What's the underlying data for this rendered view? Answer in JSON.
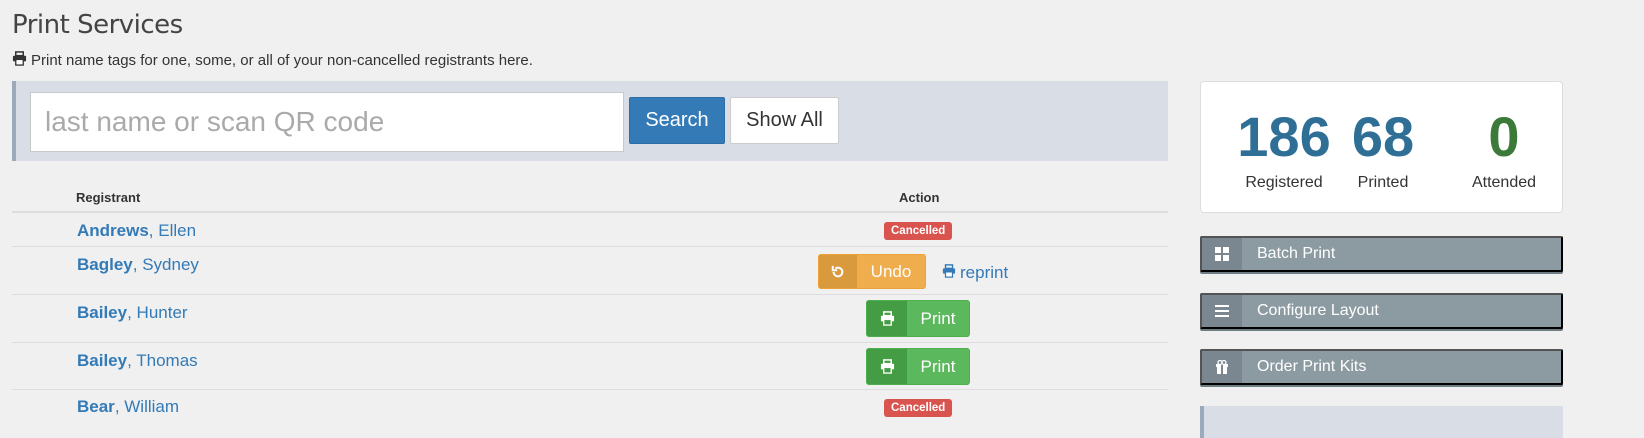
{
  "header": {
    "title": "Print Services",
    "subtitle": "Print name tags for one, some, or all of your non-cancelled registrants here."
  },
  "search": {
    "placeholder": "last name or scan QR code",
    "search_label": "Search",
    "show_all_label": "Show All"
  },
  "table": {
    "col_registrant": "Registrant",
    "col_action": "Action",
    "rows": [
      {
        "last": "Andrews",
        "first": ", Ellen",
        "status": "Cancelled"
      },
      {
        "last": "Bagley",
        "first": ", Sydney",
        "undo": "Undo",
        "reprint": "reprint"
      },
      {
        "last": "Bailey",
        "first": ", Hunter",
        "print": "Print"
      },
      {
        "last": "Bailey",
        "first": ", Thomas",
        "print": "Print"
      },
      {
        "last": "Bear",
        "first": ", William",
        "status": "Cancelled"
      }
    ]
  },
  "stats": {
    "registered": {
      "value": "186",
      "label": "Registered",
      "color": "#2f6f96"
    },
    "printed": {
      "value": "68",
      "label": "Printed",
      "color": "#2f6f96"
    },
    "attended": {
      "value": "0",
      "label": "Attended",
      "color": "#3c7a3a"
    }
  },
  "sidebar": {
    "batch_print": "Batch Print",
    "configure_layout": "Configure Layout",
    "order_kits": "Order Print Kits"
  },
  "icons": {
    "subtitle": "print-icon",
    "undo": "undo-icon",
    "reprint": "print-icon",
    "print": "print-icon",
    "batch": "grid-icon",
    "configure": "bars-icon",
    "order": "gift-icon"
  }
}
